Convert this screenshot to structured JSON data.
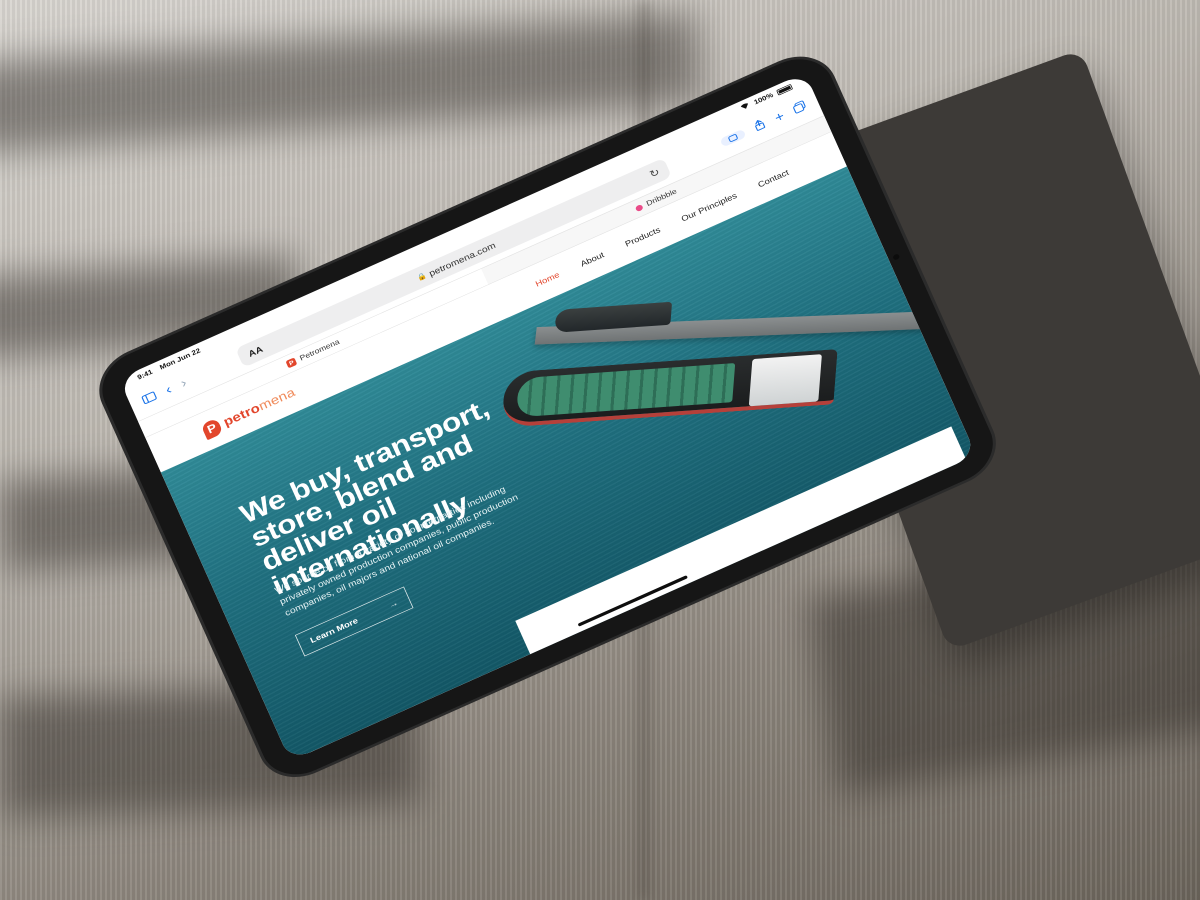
{
  "status_bar": {
    "time": "9:41",
    "date": "Mon Jun 22",
    "battery": "100%"
  },
  "browser": {
    "url": "petromena.com",
    "text_size_label": "AA",
    "tabs": [
      {
        "label": "Petromena",
        "favicon": "P"
      },
      {
        "label": "Dribbble"
      }
    ]
  },
  "site": {
    "logo": {
      "mark": "P",
      "part1": "petro",
      "part2": "mena"
    },
    "nav": [
      "Home",
      "About",
      "Products",
      "Our Principles",
      "Contact"
    ],
    "active_nav": "Home"
  },
  "hero": {
    "title": "We buy, transport, store, blend and deliver oil internationally",
    "subtitle": "We source oil from a variety of counterparties including privately owned production companies, public production companies, oil majors and national oil companies.",
    "cta_label": "Learn More",
    "cta_arrow": "→"
  },
  "colors": {
    "brand": "#e2462c",
    "brand_light": "#f08a5a",
    "hero_blue": "#1f6f7f",
    "safari_blue": "#1a73e8"
  },
  "icons": [
    "sidebar-icon",
    "back-icon",
    "forward-icon",
    "lock-icon",
    "reload-icon",
    "share-icon",
    "add-tab-icon",
    "tabs-icon",
    "arrow-right-icon"
  ]
}
